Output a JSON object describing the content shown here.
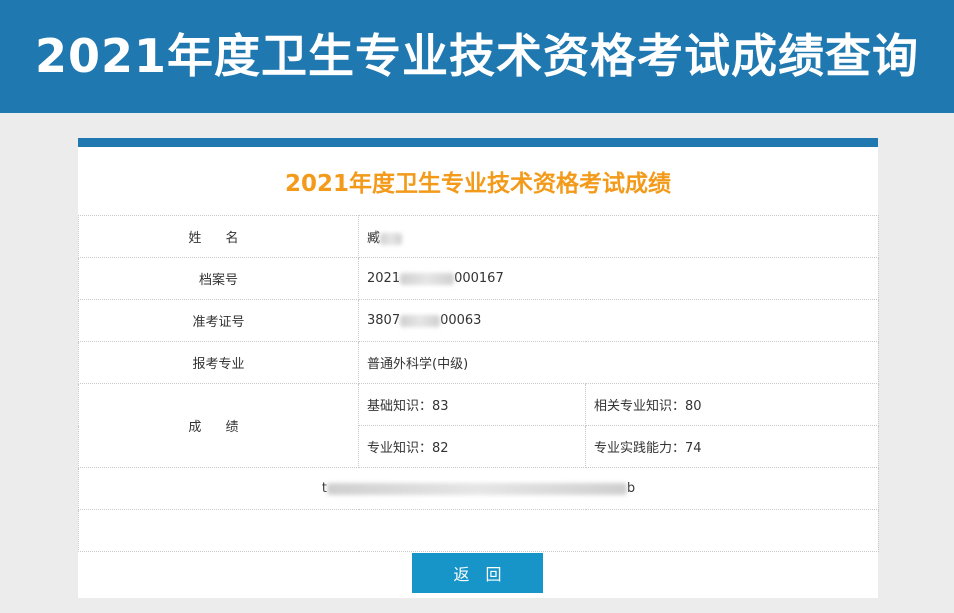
{
  "header": {
    "title": "2021年度卫生专业技术资格考试成绩查询"
  },
  "card": {
    "title": "2021年度卫生专业技术资格考试成绩",
    "name_label": "姓  名",
    "name_value": "臧",
    "file_no_label": "档案号",
    "file_no_prefix": "2021",
    "file_no_suffix": "000167",
    "ticket_label": "准考证号",
    "ticket_prefix": "3807",
    "ticket_suffix": "00063",
    "major_label": "报考专业",
    "major_value": "普通外科学(中级)",
    "score_label": "成  绩",
    "scores": [
      {
        "text": "基础知识：83"
      },
      {
        "text": "相关专业知识：80"
      },
      {
        "text": "专业知识：82"
      },
      {
        "text": "专业实践能力：74"
      }
    ],
    "hash_start": "t",
    "hash_end": "b"
  },
  "buttons": {
    "back_label": "返回"
  },
  "colors": {
    "banner": "#1f78b0",
    "title_orange": "#f39a1a",
    "button": "#1795c8"
  }
}
